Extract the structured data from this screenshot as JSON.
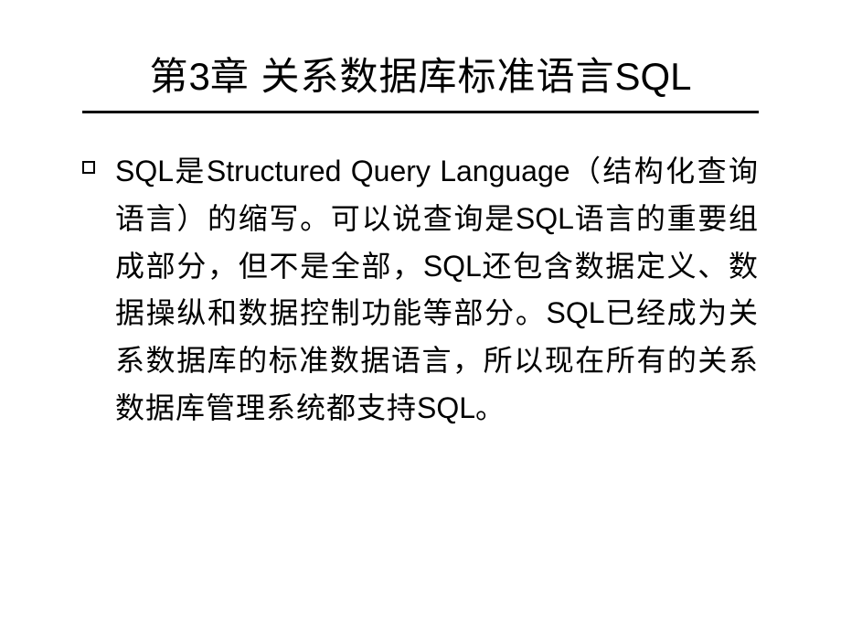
{
  "title_parts": {
    "p1": "第",
    "p2": "3",
    "p3": "章  关系数据库标准语言",
    "p4": "SQL"
  },
  "body_parts": {
    "t1": "SQL",
    "t2": "是",
    "t3": "Structured Query Language",
    "t4": "（结构化查询语言）的缩写。可以说查询是",
    "t5": "SQL",
    "t6": "语言的重要组成部分，但不是全部，",
    "t7": "SQL",
    "t8": "还包含数据定义、数据操纵和数据控制功能等部分。",
    "t9": "SQL",
    "t10": "已经成为关系数据库的标准数据语言，所以现在所有的关系数据库管理系统都支持",
    "t11": "SQL",
    "t12": "。"
  }
}
